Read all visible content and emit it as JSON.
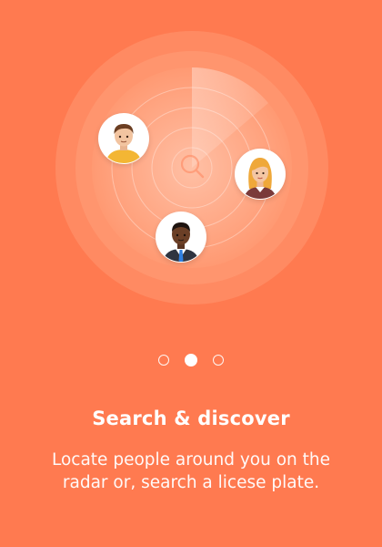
{
  "colors": {
    "background": "#FF7A50",
    "text": "#FFFFFF",
    "avatar_bg": "#FFFFFF"
  },
  "radar": {
    "icon": "search-icon",
    "people": [
      {
        "name": "man-yellow-shirt",
        "icon": "person-avatar-icon"
      },
      {
        "name": "woman-blonde",
        "icon": "person-avatar-icon"
      },
      {
        "name": "man-suit-blue-tie",
        "icon": "person-avatar-icon"
      }
    ]
  },
  "pager": {
    "count": 3,
    "active_index": 1
  },
  "onboarding": {
    "title": "Search & discover",
    "description_line1": "Locate people around you on the",
    "description_line2": "radar or, search a licese plate."
  }
}
